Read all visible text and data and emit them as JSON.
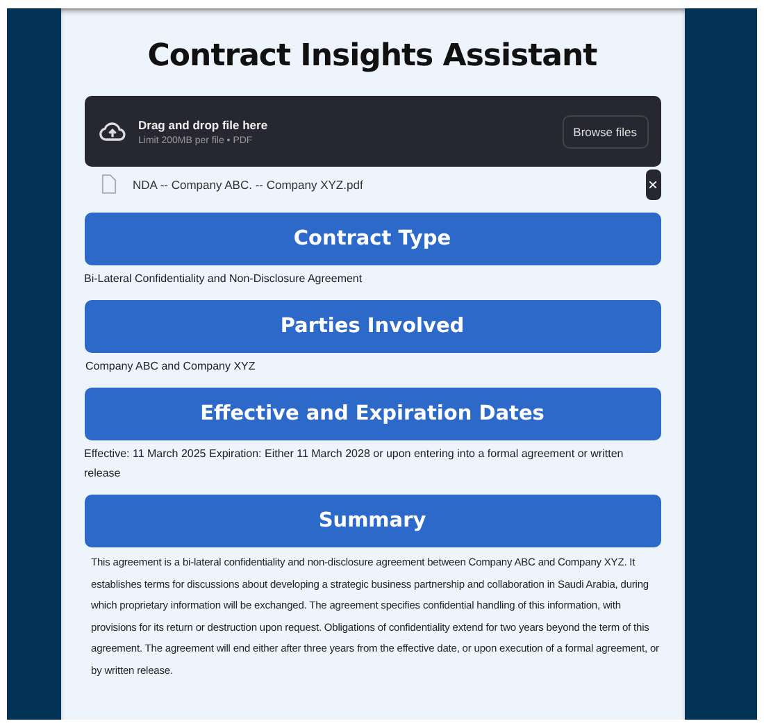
{
  "title": "Contract Insights Assistant",
  "uploader": {
    "prompt": "Drag and drop file here",
    "limit": "Limit 200MB per file • PDF",
    "button": "Browse files"
  },
  "file": {
    "name": "NDA -- Company ABC. -- Company XYZ.pdf",
    "remove": "×"
  },
  "sections": [
    {
      "heading": "Contract Type",
      "body": "Bi-Lateral Confidentiality and Non-Disclosure Agreement",
      "kind": "short"
    },
    {
      "heading": "Parties Involved",
      "body": "Company ABC and Company XYZ",
      "kind": "plain"
    },
    {
      "heading": "Effective and Expiration Dates",
      "body": "Effective: 11 March 2025 Expiration: Either 11 March 2028 or upon entering into a formal agreement or written release",
      "kind": "short"
    },
    {
      "heading": "Summary",
      "body": "This agreement is a bi-lateral confidentiality and non-disclosure agreement between Company ABC and Company XYZ. It establishes terms for discussions about developing a strategic business partnership and collaboration in Saudi Arabia, during which proprietary information will be exchanged. The agreement specifies confidential handling of this information, with provisions for its return or destruction upon request. Obligations of confidentiality extend for two years beyond the term of this agreement. The agreement will end either after three years from the effective date, or upon execution of a formal agreement, or by written release.",
      "kind": "paragraph"
    }
  ]
}
